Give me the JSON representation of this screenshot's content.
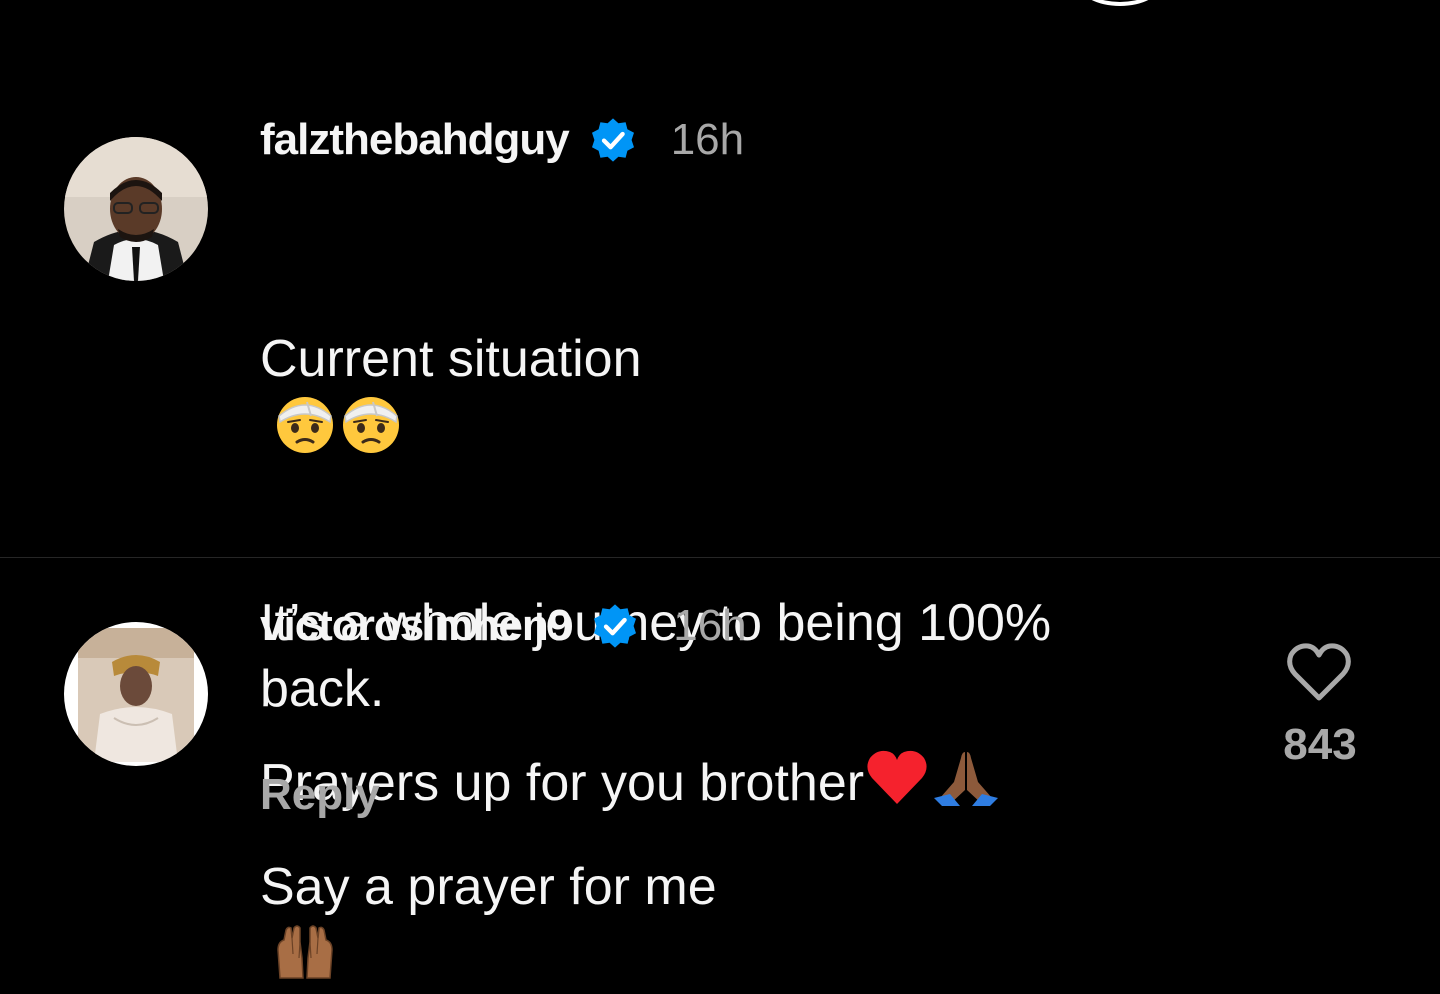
{
  "comments": [
    {
      "username": "falzthebahdguy",
      "verified": true,
      "time": "16h",
      "line1": "Current situation",
      "line2": "It’s a whole journey to being 100% back.",
      "line3": "Say a prayer for me",
      "emoji_after_line1": [
        "face-with-head-bandage",
        "face-with-head-bandage"
      ],
      "emoji_after_line3": [
        "raising-hands-medium-dark"
      ]
    },
    {
      "username": "victorosimhen9",
      "verified": true,
      "time": "16h",
      "text": "Prayers up for you brother",
      "emoji_after_text": [
        "red-heart",
        "folded-hands-medium-dark"
      ],
      "reply_label": "Reply",
      "like_count": "843"
    }
  ],
  "colors": {
    "background": "#000000",
    "text": "#f5f5f5",
    "secondary_text": "#a8a8a8",
    "verified_badge": "#0095f6",
    "divider": "#262626"
  }
}
